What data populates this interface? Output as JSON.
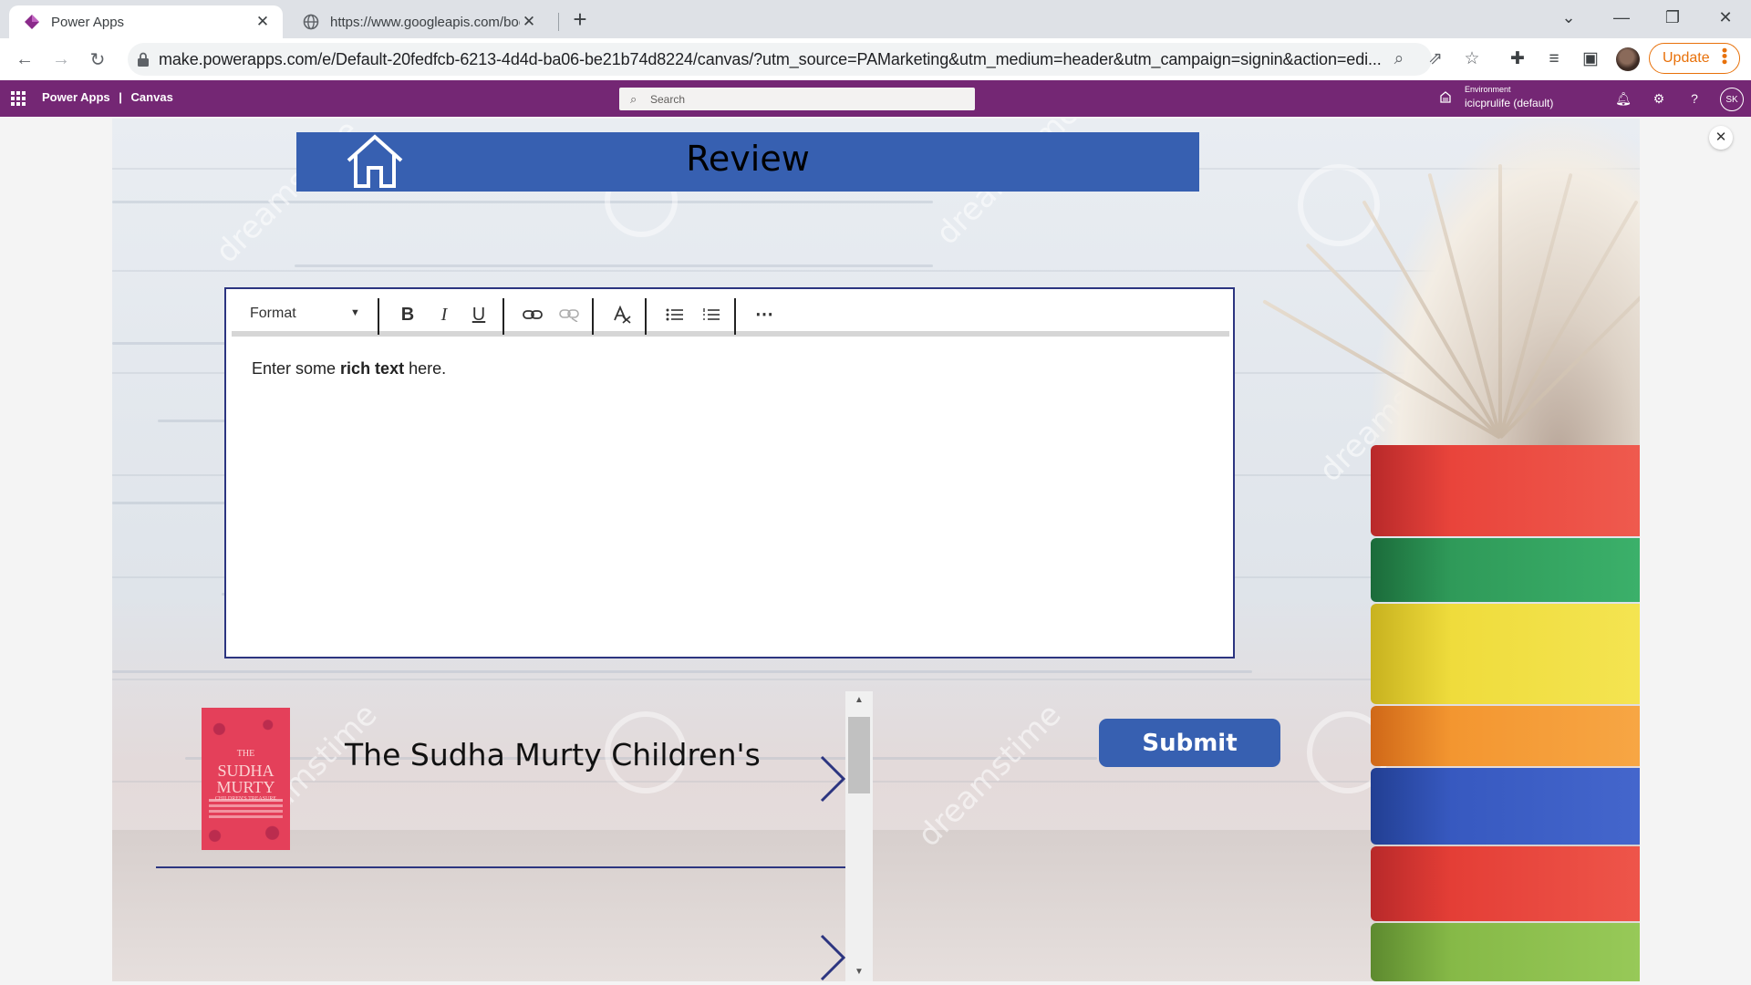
{
  "browser": {
    "tabs": [
      {
        "title": "Power Apps",
        "active": true
      },
      {
        "title": "https://www.googleapis.com/boo",
        "active": false
      }
    ],
    "url": "make.powerapps.com/e/Default-20fedfcb-6213-4d4d-ba06-be21b74d8224/canvas/?utm_source=PAMarketing&utm_medium=header&utm_campaign=signin&action=edi...",
    "update_label": "Update"
  },
  "powerapps": {
    "brand": "Power Apps",
    "separator": "|",
    "mode": "Canvas",
    "search_placeholder": "Search",
    "environment_label": "Environment",
    "environment_name": "icicprulife (default)",
    "user_initials": "SK"
  },
  "app": {
    "title": "Review",
    "editor": {
      "format_label": "Format",
      "text_before": "Enter some ",
      "text_bold": "rich text",
      "text_after": " here."
    },
    "gallery": {
      "items": [
        {
          "title": "The Sudha Murty Children's",
          "cover_line1": "THE",
          "cover_line2": "SUDHA",
          "cover_line3": "MURTY",
          "cover_line4": "CHILDREN'S TREASURE"
        }
      ]
    },
    "submit_label": "Submit",
    "watermark": "dreamstime"
  },
  "colors": {
    "powerapps_header": "#742774",
    "app_header_bar": "#3760b1",
    "submit_button": "#3760b1",
    "editor_border": "#2c3580",
    "update_accent": "#e8710a"
  }
}
